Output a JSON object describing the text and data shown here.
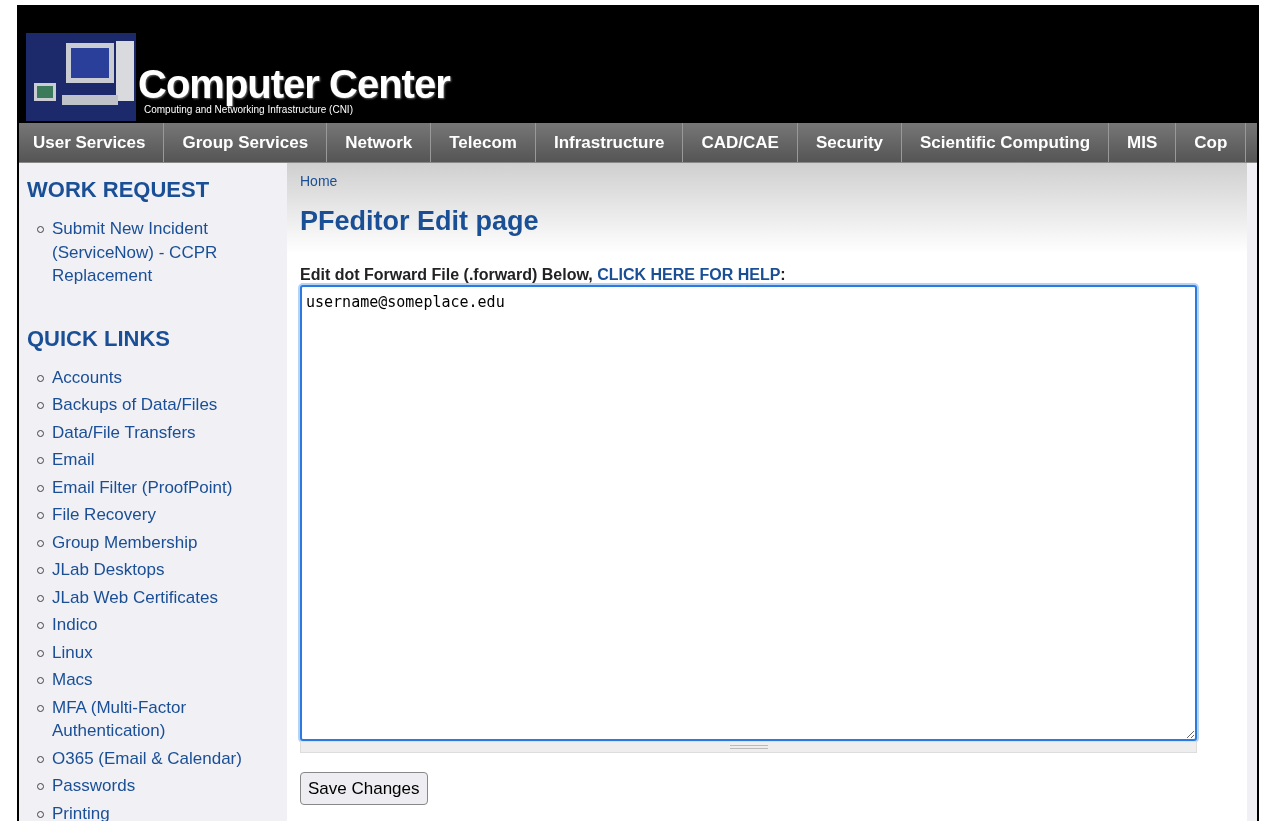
{
  "header": {
    "title": "Computer Center",
    "subtitle": "Computing and Networking Infrastructure (CNI)"
  },
  "nav": [
    "User Services",
    "Group Services",
    "Network",
    "Telecom",
    "Infrastructure",
    "CAD/CAE",
    "Security",
    "Scientific Computing",
    "MIS",
    "Cop"
  ],
  "sidebar": [
    {
      "heading": "WORK REQUEST",
      "links": [
        "Submit New Incident (ServiceNow) - CCPR Replacement"
      ]
    },
    {
      "heading": "QUICK LINKS",
      "links": [
        "Accounts",
        "Backups of Data/Files",
        "Data/File Transfers",
        "Email",
        "Email Filter (ProofPoint)",
        "File Recovery",
        "Group Membership",
        "JLab Desktops",
        "JLab Web Certificates",
        "Indico",
        "Linux",
        "Macs",
        "MFA (Multi-Factor Authentication)",
        "O365 (Email & Calendar)",
        "Passwords",
        "Printing"
      ]
    }
  ],
  "breadcrumb": "Home",
  "page_title": "PFeditor Edit page",
  "form": {
    "label": "Edit dot Forward File (.forward) Below,",
    "help_link": "CLICK HERE FOR HELP",
    "label_end": ":",
    "value": "username@someplace.edu",
    "button": "Save Changes"
  }
}
